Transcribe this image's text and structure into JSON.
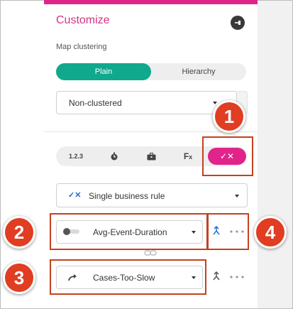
{
  "panel": {
    "title": "Customize"
  },
  "clustering": {
    "label": "Map clustering",
    "options": [
      "Plain",
      "Hierarchy"
    ],
    "selected": "Plain",
    "dropdown_value": "Non-clustered"
  },
  "modes": {
    "items": [
      "1.2.3",
      "timer",
      "briefcase",
      "Fx",
      "rules"
    ],
    "num_label": "1.2.3",
    "fx_label": "F",
    "fx_sub": "x",
    "active_label": "✓✕"
  },
  "rule": {
    "type_value": "Single business rule",
    "type_icon": "✓✕"
  },
  "metric": {
    "value": "Avg-Event-Duration"
  },
  "case": {
    "value": "Cases-Too-Slow"
  },
  "badges": [
    "1",
    "2",
    "3",
    "4"
  ],
  "colors": {
    "accent": "#e0248a",
    "teal": "#11a98d",
    "callout": "#c4411f",
    "badge": "#e03d22"
  }
}
